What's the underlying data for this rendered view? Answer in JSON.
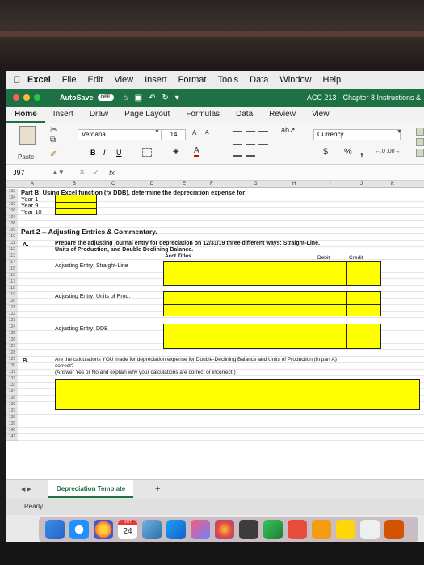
{
  "menubar": {
    "app": "Excel",
    "items": [
      "File",
      "Edit",
      "View",
      "Insert",
      "Format",
      "Tools",
      "Data",
      "Window",
      "Help"
    ]
  },
  "titlebar": {
    "autosave_label": "AutoSave",
    "autosave_state": "OFF",
    "document_title": "ACC 213 - Chapter 8 Instructions &"
  },
  "ribbon": {
    "tabs": [
      "Home",
      "Insert",
      "Draw",
      "Page Layout",
      "Formulas",
      "Data",
      "Review",
      "View"
    ],
    "paste_label": "Paste",
    "font_name": "Verdana",
    "font_size": "14",
    "grow_label": "A",
    "shrink_label": "A",
    "bold": "B",
    "italic": "I",
    "underline": "U",
    "number_format": "Currency",
    "dollar": "$",
    "percent": "%",
    "comma": ",",
    "decimals": "←.0 .00→"
  },
  "formula_bar": {
    "name_box": "J97",
    "fx": "fx"
  },
  "sheet": {
    "columns": [
      "A",
      "B",
      "C",
      "D",
      "E",
      "F",
      "G",
      "H",
      "I",
      "J",
      "K"
    ],
    "part_b_title": "Part B: Using Excel function (fx DDB), determine the depreciation expense for:",
    "year_1": "Year 1",
    "year_9": "Year 9",
    "year_10": "Year 10",
    "part2_title": "Part 2 -- Adjusting Entries & Commentary.",
    "a_label": "A.",
    "a_instructions_1": "Prepare the adjusting journal entry for depreciation on 12/31/19 three different ways: Straight-Line,",
    "a_instructions_2": "Units of Production, and Double Declining Balance.",
    "acct_titles": "Acct Titles",
    "debit": "Debit",
    "credit": "Credit",
    "entry_sl": "Adjusting Entry: Straight-Line",
    "entry_units": "Adjusting Entry: Units of Prod.",
    "entry_ddb": "Adjusting Entry: DDB",
    "b_label": "B.",
    "b_question_1": "Are the calculations YOU made for depreciation expense for Double-Declining Balance and Units of Production (in part A)",
    "b_question_2": "correct?",
    "b_question_3": "(Answer Yes or No and explain why your calculations are correct or incorrect.)",
    "row_numbers": [
      "103",
      "104",
      "105",
      "106",
      "107",
      "108",
      "109",
      "110",
      "111",
      "112",
      "113",
      "114",
      "115",
      "116",
      "117",
      "118",
      "119",
      "120",
      "121",
      "122",
      "123",
      "124",
      "125",
      "126",
      "127",
      "128",
      "129",
      "130",
      "131",
      "132",
      "133",
      "134",
      "135",
      "136",
      "137",
      "138",
      "139",
      "140",
      "141"
    ]
  },
  "sheet_tabs": {
    "active": "Depreciation Template",
    "add": "+"
  },
  "status": "Ready",
  "dock": {
    "calendar_day": "24"
  },
  "colors": {
    "excel_green": "#1e7145",
    "cell_fill": "#ffff00"
  }
}
